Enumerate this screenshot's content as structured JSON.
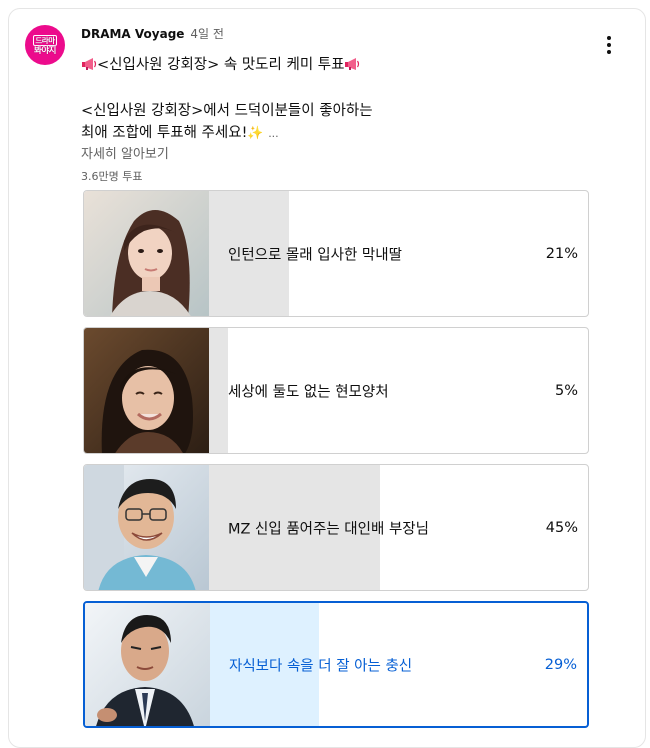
{
  "post": {
    "channel_name": "DRAMA Voyage",
    "time_ago": "4일 전",
    "avatar_text_top": "드라마",
    "avatar_text_bottom": "봐야지",
    "title": "<신입사원 강회장> 속 맛도리 케미 투표",
    "body_line1": "<신입사원 강회장>에서 드덕이분들이 좋아하는",
    "body_line2": "최애 조합에 투표해 주세요!",
    "sparkle": "✨",
    "truncation": "...",
    "more_label": "자세히 알아보기",
    "vote_count": "3.6만명 투표"
  },
  "poll": {
    "options": [
      {
        "label": "인턴으로 몰래 입사한 막내딸",
        "percent_text": "21%",
        "percent": 21,
        "selected": false
      },
      {
        "label": "세상에 둘도 없는 현모양처",
        "percent_text": "5%",
        "percent": 5,
        "selected": false
      },
      {
        "label": "MZ 신입 품어주는 대인배 부장님",
        "percent_text": "45%",
        "percent": 45,
        "selected": false
      },
      {
        "label": "자식보다 속을 더 잘 아는 충신",
        "percent_text": "29%",
        "percent": 29,
        "selected": true
      }
    ]
  },
  "icons": {
    "megaphone": "megaphone-icon",
    "menu": "more-vert-icon"
  },
  "colors": {
    "avatar_bg": "#ec0b8c",
    "selected_accent": "#065fd4",
    "selected_bar": "#def1ff",
    "bar": "#e5e5e5",
    "secondary_text": "#606060"
  }
}
